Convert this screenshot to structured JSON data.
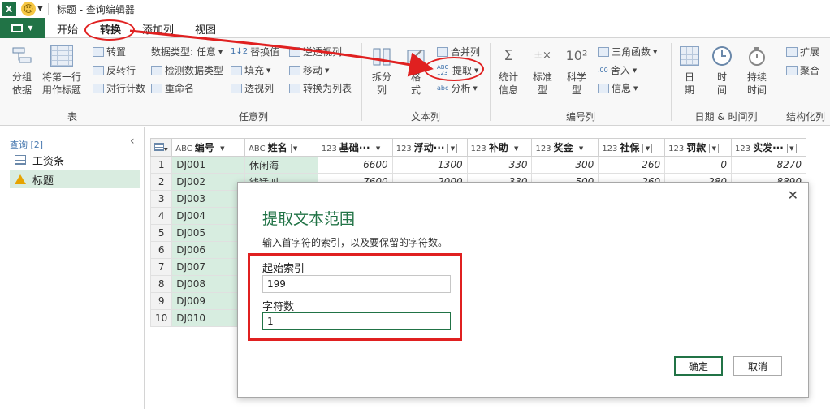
{
  "window": {
    "title": "标题 - 查询编辑器"
  },
  "tabs": [
    "开始",
    "转换",
    "添加列",
    "视图"
  ],
  "ribbon": {
    "table_group": {
      "label": "表",
      "group_by": [
        "分组",
        "依据"
      ],
      "first_row": [
        "将第一行",
        "用作标题"
      ],
      "transpose": "转置",
      "reverse": "反转行",
      "count_rows": "对行计数"
    },
    "any_col": {
      "label": "任意列",
      "data_type": "数据类型: 任意",
      "detect": "检测数据类型",
      "rename": "重命名",
      "replace": "替换值",
      "fill": "填充",
      "pivot": "透视列",
      "unpivot": "逆透视列",
      "move": "移动",
      "to_list": "转换为列表"
    },
    "text_col": {
      "label": "文本列",
      "split": [
        "拆分",
        "列"
      ],
      "format": [
        "格",
        "式"
      ],
      "merge": "合并列",
      "extract": "提取",
      "parse": "分析"
    },
    "num_col": {
      "label": "编号列",
      "stats": [
        "统计",
        "信息"
      ],
      "standard": [
        "标准",
        "型"
      ],
      "scientific": [
        "科学",
        "型"
      ],
      "trig": "三角函数",
      "round": "舍入",
      "info": "信息"
    },
    "datetime": {
      "label": "日期 & 时间列",
      "date": [
        "日",
        "期"
      ],
      "time": [
        "时",
        "间"
      ],
      "duration": [
        "持续",
        "时间"
      ]
    },
    "structured": {
      "label": "结构化列",
      "expand": "扩展",
      "aggregate": "聚合"
    }
  },
  "queries": {
    "header": "查询 [2]",
    "items": [
      {
        "name": "工资条"
      },
      {
        "name": "标题"
      }
    ]
  },
  "grid": {
    "columns": [
      {
        "type": "ABC",
        "name": "编号"
      },
      {
        "type": "ABC",
        "name": "姓名"
      },
      {
        "type": "123",
        "name": "基础···"
      },
      {
        "type": "123",
        "name": "浮动···"
      },
      {
        "type": "123",
        "name": "补助"
      },
      {
        "type": "123",
        "name": "奖金"
      },
      {
        "type": "123",
        "name": "社保"
      },
      {
        "type": "123",
        "name": "罚款"
      },
      {
        "type": "123",
        "name": "实发···"
      }
    ],
    "rows": [
      {
        "n": "1",
        "id": "DJ001",
        "name": "休闲海",
        "v": [
          "6600",
          "1300",
          "330",
          "300",
          "260",
          "0",
          "8270"
        ]
      },
      {
        "n": "2",
        "id": "DJ002",
        "name": "钱猛叫",
        "v": [
          "7600",
          "2000",
          "330",
          "500",
          "260",
          "280",
          "8890"
        ]
      },
      {
        "n": "3",
        "id": "DJ003"
      },
      {
        "n": "4",
        "id": "DJ004"
      },
      {
        "n": "5",
        "id": "DJ005"
      },
      {
        "n": "6",
        "id": "DJ006"
      },
      {
        "n": "7",
        "id": "DJ007"
      },
      {
        "n": "8",
        "id": "DJ008"
      },
      {
        "n": "9",
        "id": "DJ009"
      },
      {
        "n": "10",
        "id": "DJ010"
      }
    ]
  },
  "dialog": {
    "title": "提取文本范围",
    "description": "输入首字符的索引，以及要保留的字符数。",
    "start_label": "起始索引",
    "start_value": "199",
    "count_label": "字符数",
    "count_value": "1",
    "ok": "确定",
    "cancel": "取消"
  }
}
